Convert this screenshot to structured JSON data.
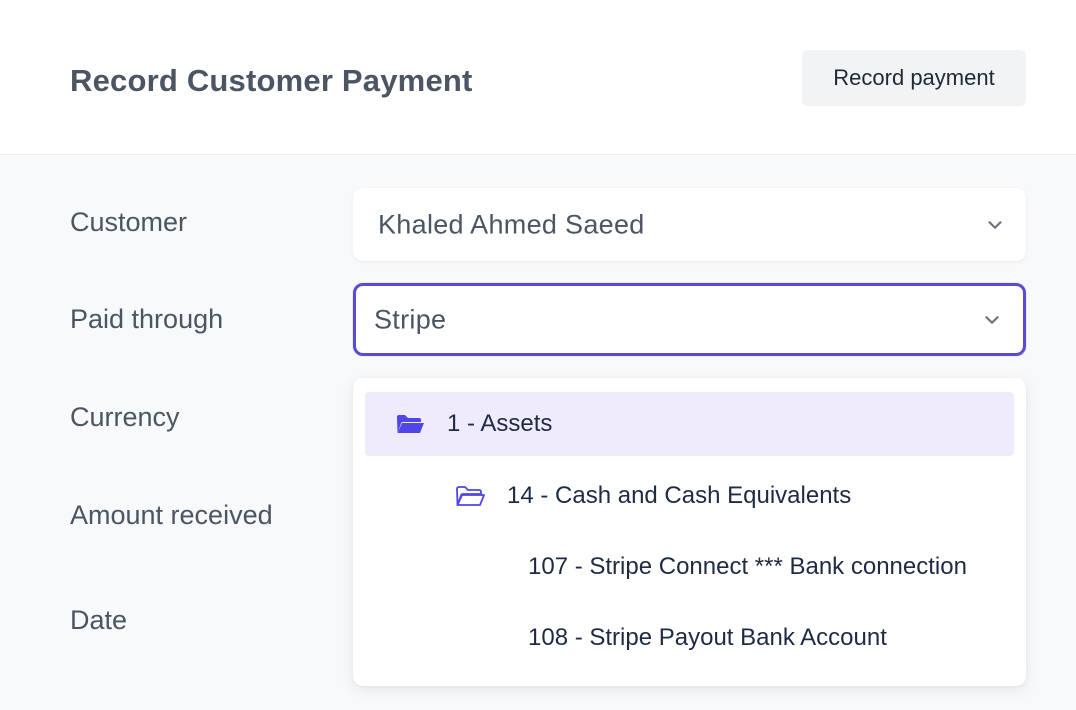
{
  "header": {
    "title": "Record Customer Payment",
    "record_button_label": "Record payment"
  },
  "form": {
    "customer": {
      "label": "Customer",
      "value": "Khaled Ahmed Saeed"
    },
    "paid_through": {
      "label": "Paid through",
      "value": "Stripe"
    },
    "currency": {
      "label": "Currency"
    },
    "amount_received": {
      "label": "Amount received"
    },
    "date": {
      "label": "Date"
    }
  },
  "dropdown": {
    "options": [
      {
        "label": "1 - Assets",
        "icon": "folder-open-icon",
        "level": 0,
        "highlighted": true
      },
      {
        "label": "14 - Cash and Cash Equivalents",
        "icon": "folder-open-icon",
        "level": 1,
        "highlighted": false
      },
      {
        "label": "107 - Stripe Connect *** Bank connection",
        "level": 2,
        "highlighted": false
      },
      {
        "label": "108 - Stripe Payout Bank Account",
        "level": 2,
        "highlighted": false
      }
    ]
  },
  "colors": {
    "accent": "#5b4bd1",
    "highlight_bg": "#efeafc",
    "panel_bg": "#f8f9fb"
  }
}
